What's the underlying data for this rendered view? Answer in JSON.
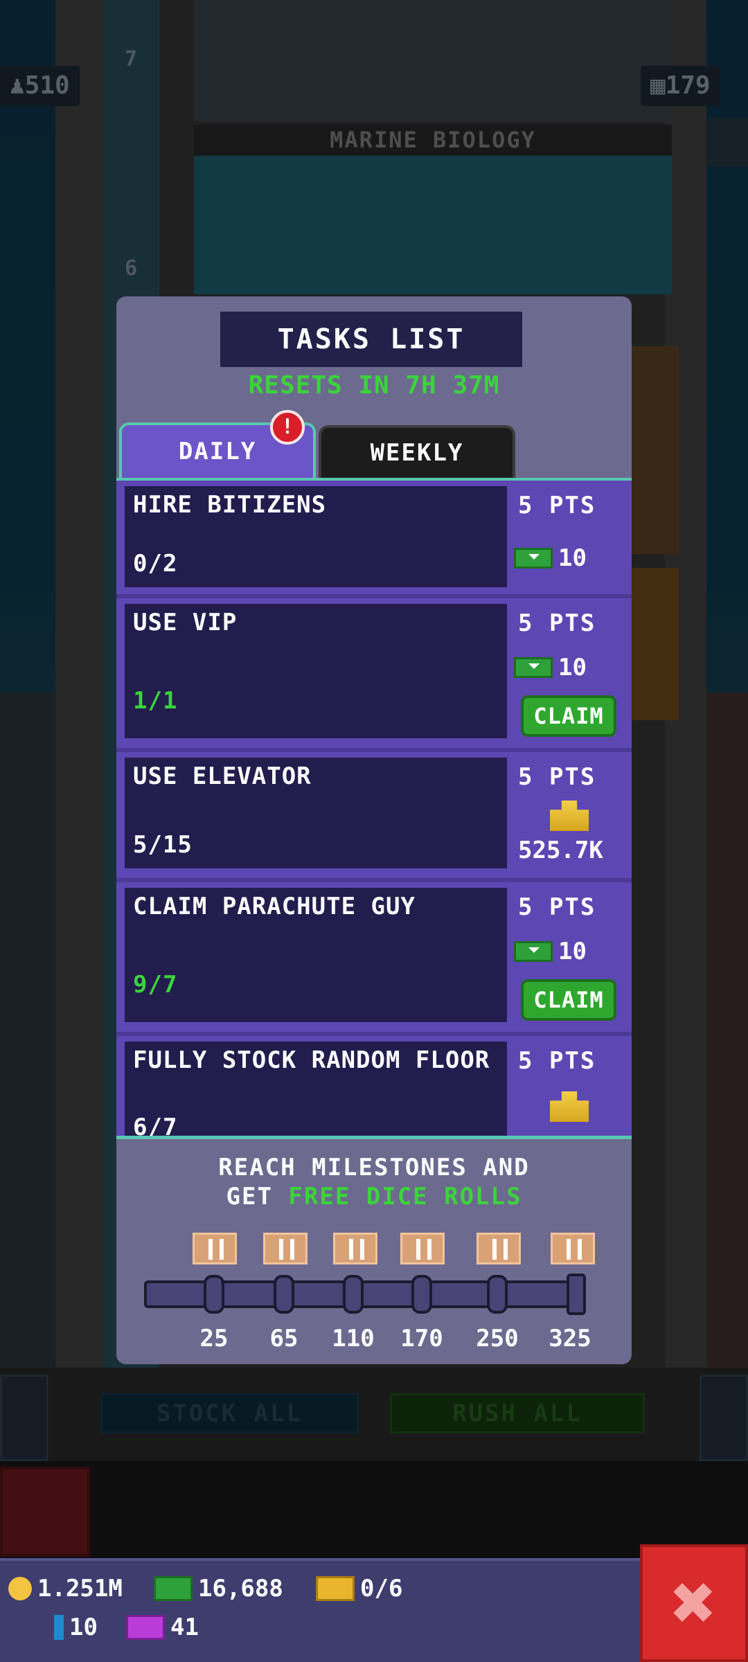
{
  "hud": {
    "population": "510",
    "floors": "179",
    "floor_label": "MARINE BIOLOGY",
    "floor_num_top": "7",
    "floor_num_mid": "6"
  },
  "panel": {
    "title": "TASKS LIST",
    "resets": "RESETS IN 7H 37M",
    "tabs": [
      {
        "label": "DAILY",
        "active": true,
        "badge": "!"
      },
      {
        "label": "WEEKLY",
        "active": false
      }
    ]
  },
  "tasks": [
    {
      "name": "HIRE BITIZENS",
      "progress": "0/2",
      "pts": "5 PTS",
      "reward_value": "10",
      "reward_type": "bux",
      "claim": ""
    },
    {
      "name": "USE VIP",
      "progress": "1/1",
      "pts": "5 PTS",
      "reward_value": "10",
      "reward_type": "bux",
      "claim": "CLAIM"
    },
    {
      "name": "USE ELEVATOR",
      "progress": "5/15",
      "pts": "5 PTS",
      "reward_value": "525.7K",
      "reward_type": "coins",
      "claim": ""
    },
    {
      "name": "CLAIM PARACHUTE GUY",
      "progress": "9/7",
      "pts": "5 PTS",
      "reward_value": "10",
      "reward_type": "bux",
      "claim": "CLAIM"
    },
    {
      "name": "FULLY STOCK RANDOM FLOOR",
      "progress": "6/7",
      "pts": "5 PTS",
      "reward_value": "",
      "reward_type": "coins",
      "claim": ""
    }
  ],
  "milestones": {
    "text_line1": "REACH MILESTONES AND",
    "text_line2_prefix": "GET ",
    "text_line2_highlight": "FREE DICE ROLLS",
    "values": [
      "25",
      "65",
      "110",
      "170",
      "250",
      "325"
    ]
  },
  "toolbar": {
    "stock_all": "STOCK ALL",
    "rush_all": "RUSH ALL"
  },
  "currency": {
    "coins": "1.251M",
    "bux": "16,688",
    "tickets": "0/6",
    "gems": "10",
    "vip": "41"
  },
  "close_icon": "✖",
  "colors": {
    "accent_green": "#3bd43b",
    "panel_purple": "#5d47b3",
    "close_red": "#d92b2b"
  }
}
